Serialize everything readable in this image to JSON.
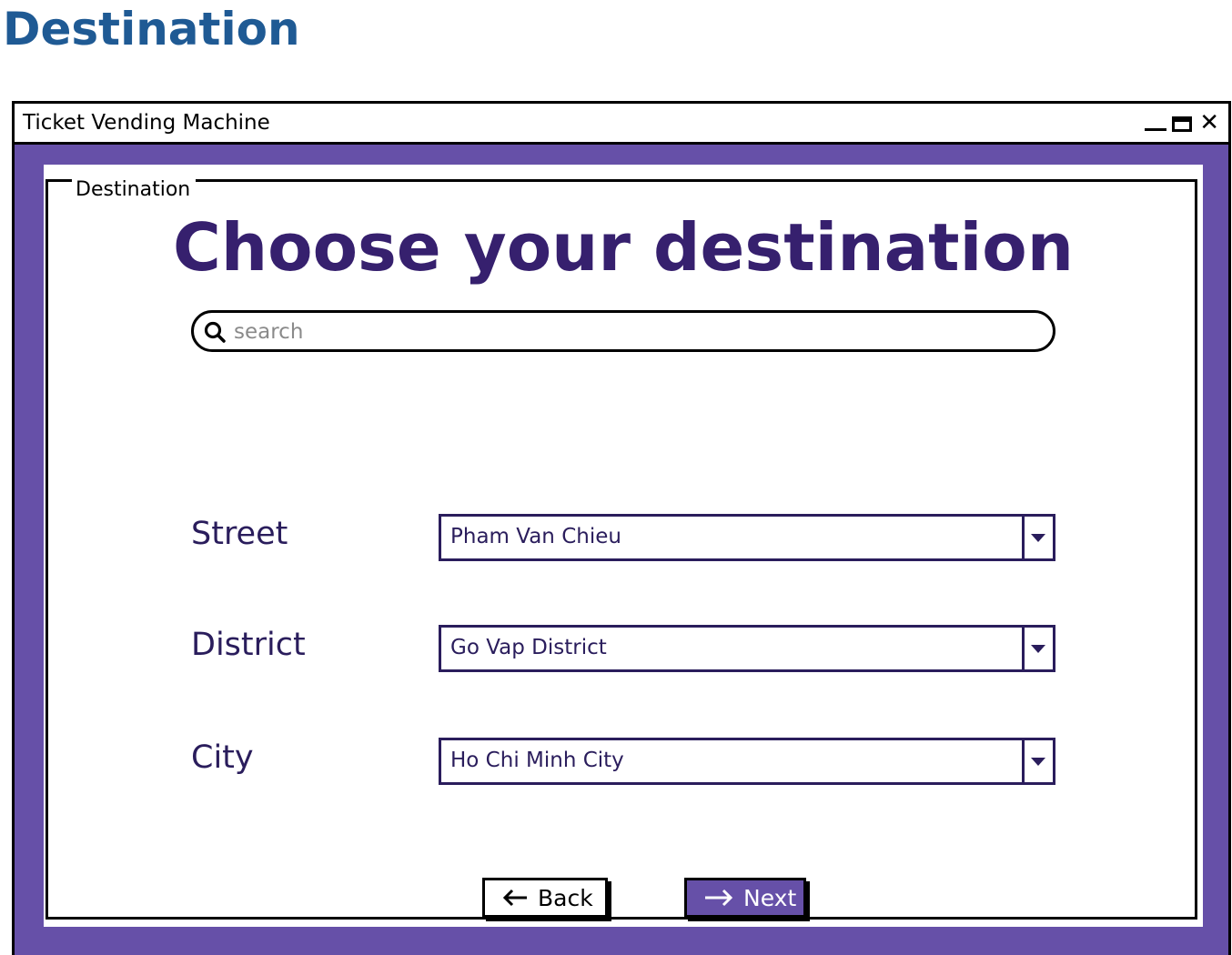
{
  "page": {
    "heading": "Destination"
  },
  "window": {
    "title": "Ticket Vending Machine"
  },
  "panel": {
    "legend": "Destination",
    "title": "Choose your destination"
  },
  "search": {
    "placeholder": "search",
    "value": ""
  },
  "fields": {
    "street": {
      "label": "Street",
      "value": "Pham Van Chieu"
    },
    "district": {
      "label": "District",
      "value": "Go Vap District"
    },
    "city": {
      "label": "City",
      "value": "Ho Chi Minh City"
    }
  },
  "buttons": {
    "back_label": "Back",
    "next_label": "Next"
  },
  "colors": {
    "heading": "#1f5a94",
    "window_frame": "#6650a8",
    "title_text": "#36206e",
    "label_text": "#2a1d5c"
  },
  "icons": {
    "search": "search-icon",
    "back": "arrow-left-icon",
    "next": "arrow-right-icon",
    "minimize": "minimize-icon",
    "maximize": "maximize-icon",
    "close": "close-icon"
  }
}
